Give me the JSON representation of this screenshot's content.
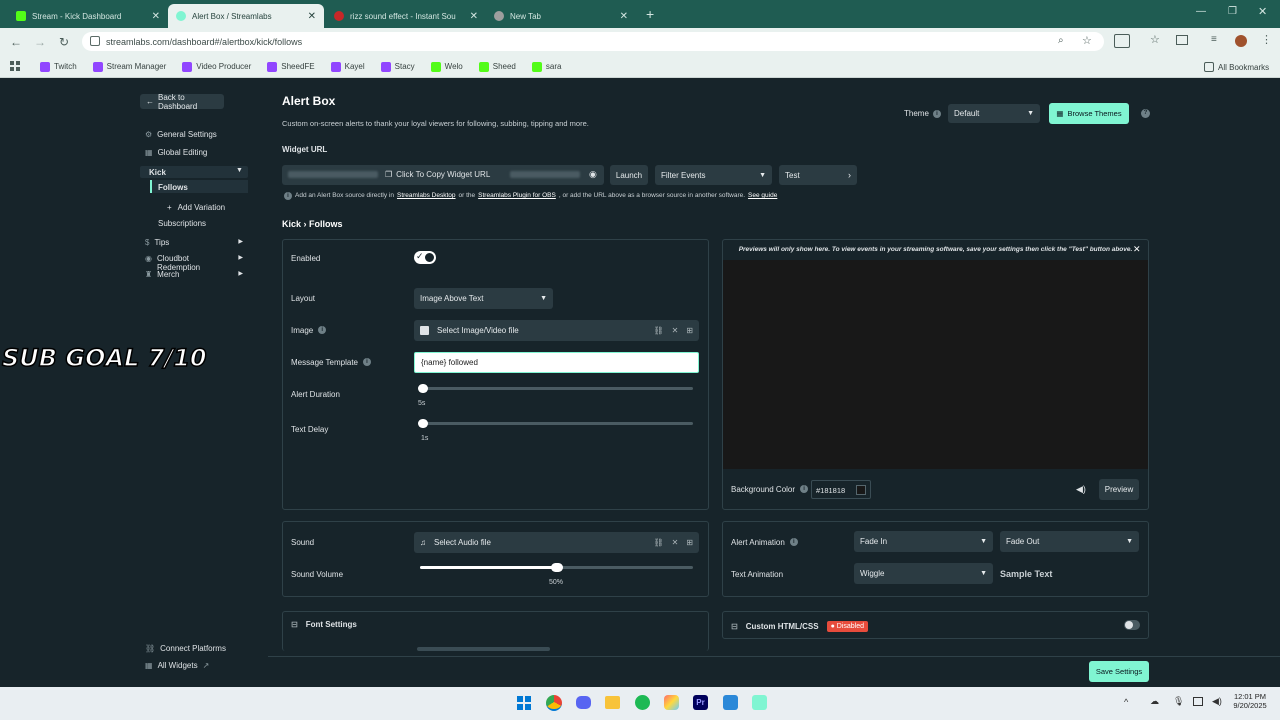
{
  "browser": {
    "tabs": [
      {
        "title": "Stream - Kick Dashboard",
        "color": "#53fc18"
      },
      {
        "title": "Alert Box / Streamlabs",
        "color": "#80f5d2"
      },
      {
        "title": "rizz sound effect - Instant Sou",
        "color": "#c62828"
      },
      {
        "title": "New Tab",
        "color": "#9e9e9e"
      }
    ],
    "url": "streamlabs.com/dashboard#/alertbox/kick/follows",
    "bookmarks": [
      "Twitch",
      "Stream Manager",
      "Video Producer",
      "SheedFE",
      "Kayel",
      "Stacy",
      "Welo",
      "Sheed",
      "sara"
    ],
    "all_bookmarks": "All Bookmarks"
  },
  "sidebar": {
    "back": "Back to Dashboard",
    "general": "General Settings",
    "global": "Global Editing",
    "kick": "Kick",
    "follows": "Follows",
    "add_variation": "Add Variation",
    "subscriptions": "Subscriptions",
    "tips": "Tips",
    "cloudbot": "Cloudbot Redemption",
    "merch": "Merch",
    "connect": "Connect Platforms",
    "all_widgets": "All Widgets"
  },
  "overlay_text": "SUB GOAL 7/10",
  "header": {
    "title": "Alert Box",
    "subtitle": "Custom on-screen alerts to thank your loyal viewers for following, subbing, tipping and more.",
    "theme_label": "Theme",
    "theme_value": "Default",
    "browse_themes": "Browse Themes"
  },
  "widget": {
    "label": "Widget URL",
    "copy": "Click To Copy Widget URL",
    "launch": "Launch",
    "filter": "Filter Events",
    "test": "Test",
    "help_prefix": "Add an Alert Box source directly in",
    "help_link1": "Streamlabs Desktop",
    "help_mid": "or the",
    "help_link2": "Streamlabs Plugin for OBS",
    "help_suffix": ", or add the URL above as a browser source in another software.",
    "help_link3": "See guide"
  },
  "section_title": "Kick › Follows",
  "form": {
    "enabled": "Enabled",
    "layout": "Layout",
    "layout_value": "Image Above Text",
    "image": "Image",
    "image_value": "Select Image/Video file",
    "message_template": "Message Template",
    "message_value": "{name} followed",
    "alert_duration": "Alert Duration",
    "alert_duration_value": "5s",
    "text_delay": "Text Delay",
    "text_delay_value": "1s"
  },
  "preview": {
    "notice": "Previews will only show here. To view events in your streaming software, save your settings then click the \"Test\" button above.",
    "bg_label": "Background Color",
    "bg_value": "#181818",
    "preview_btn": "Preview"
  },
  "sound": {
    "label": "Sound",
    "value": "Select Audio file",
    "volume_label": "Sound Volume",
    "volume_value": "50%",
    "volume_level": 0.5
  },
  "animation": {
    "alert_label": "Alert Animation",
    "in_value": "Fade In",
    "out_value": "Fade Out",
    "text_label": "Text Animation",
    "text_value": "Wiggle",
    "sample": "Sample Text"
  },
  "font_settings": "Font Settings",
  "custom": {
    "label": "Custom HTML/CSS",
    "badge": "Disabled"
  },
  "save": "Save Settings",
  "taskbar": {
    "time": "12:01 PM",
    "date": "9/20/2025"
  }
}
